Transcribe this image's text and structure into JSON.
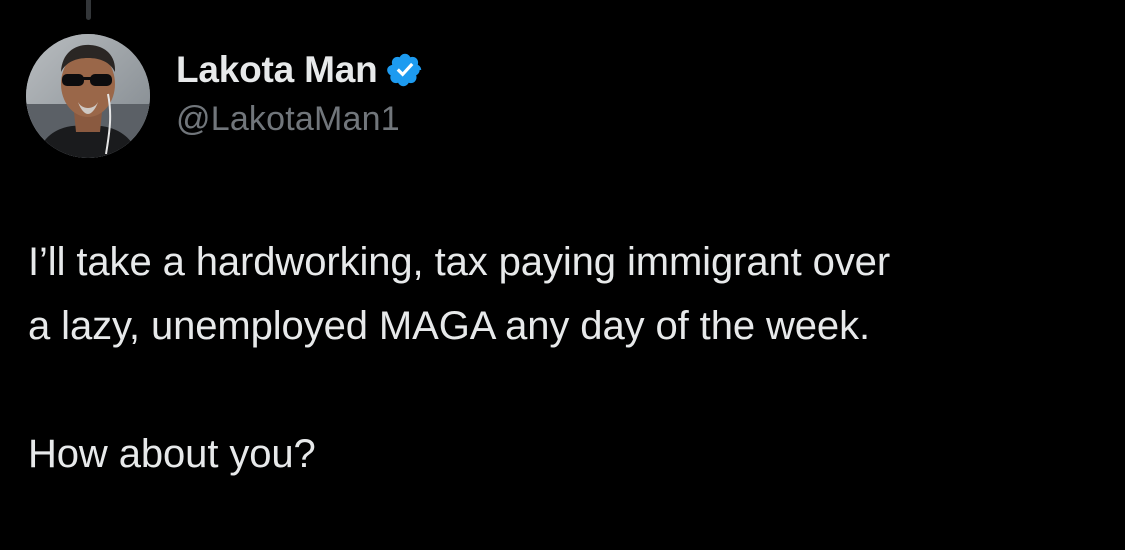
{
  "tweet": {
    "author": {
      "display_name": "Lakota Man",
      "handle": "@LakotaMan1",
      "verified": true,
      "verified_icon": "verified-badge-icon",
      "avatar_icon": "profile-photo"
    },
    "text_lines": [
      "I’ll take a hardworking, tax paying immigrant over",
      "a lazy, unemployed MAGA any day of the week.",
      "How about you?"
    ]
  },
  "colors": {
    "background": "#000000",
    "primary_text": "#e7e9ea",
    "secondary_text": "#71767b",
    "verified_blue": "#1d9bf0",
    "thread_line": "#333639"
  }
}
